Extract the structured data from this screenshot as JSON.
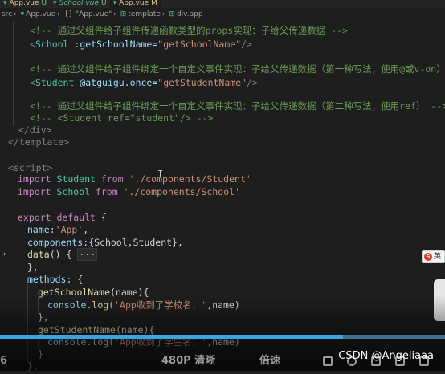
{
  "tabs": [
    {
      "label": "App.vue",
      "badge": "U",
      "label_color": "#e2c08d",
      "active": false
    },
    {
      "label": "School.vue",
      "badge": "U",
      "label_color": "#4fc08d",
      "active": false
    },
    {
      "label": "App.vue",
      "badge": "M",
      "label_color": "#e2c08d",
      "active": true
    }
  ],
  "breadcrumbs": [
    "src",
    "App.vue",
    "{} \"App.vue\"",
    "template",
    "div.app"
  ],
  "code": {
    "line_01_comment": "<!-- 通过父组件给子组件传递函数类型的props实现：子给父传递数据 -->",
    "line_02": {
      "lt": "<",
      "tag": "School",
      "attr": " :getSchoolName=",
      "value": "\"getSchoolName\"",
      "end": "/>"
    },
    "line_04_comment": "<!-- 通过父组件给子组件绑定一个自定义事件实现：子给父传递数据（第一种写法，使用@或v-on）",
    "line_05": {
      "lt": "<",
      "tag": "Student",
      "attr": " @atguigu.once=",
      "value": "\"getStudentName\"",
      "end": "/>"
    },
    "line_07_comment": "<!-- 通过父组件给子组件绑定一个自定义事件实现：子给父传递数据（第二种写法，使用ref） -->",
    "line_08_comment": "<!-- <Student ref=\"student\"/> -->",
    "line_09_close_div": "</div>",
    "line_10_close_template": "</template>",
    "line_12_script": "<script>",
    "line_13": {
      "kw": "import",
      "name": " Student ",
      "from": "from",
      "path": " './components/Student'"
    },
    "line_14": {
      "kw": "import",
      "name": " School ",
      "from": "from",
      "path": " './components/School'"
    },
    "line_16": {
      "kw": "export default",
      "rest": " {"
    },
    "line_17": {
      "key": "name",
      "sep": ":",
      "value": "'App'",
      "end": ","
    },
    "line_18": {
      "key": "components",
      "sep": ":",
      "value": "{School,Student}",
      "end": ","
    },
    "line_19": {
      "fn": "data",
      "rest": "() {",
      "folded": "···"
    },
    "line_20": "},",
    "line_21": {
      "key": "methods",
      "rest": ": {"
    },
    "line_22": {
      "fn": "getSchoolName",
      "param": "(name){"
    },
    "line_23": {
      "obj": "console",
      "fn": ".log",
      "open": "(",
      "str": "'App收到了学校名：'",
      "rest": ",name)"
    },
    "line_24": "},",
    "line_25": {
      "fn": "getStudentName",
      "param": "(name){"
    },
    "line_26": {
      "obj": "console",
      "fn": ".log",
      "open": "(",
      "str": "'App收到了学生名：'",
      "rest": ",name)"
    },
    "line_27": "}",
    "line_28": "},"
  },
  "ime": {
    "badge": "S",
    "label": "英"
  },
  "player": {
    "left_text": "6",
    "quality": "480P 清晰",
    "speed": "倍速",
    "progress": 0.77
  },
  "watermark": "CSDN @Angeliaaa",
  "colors": {
    "editor_bg": "#1e1e1e",
    "comment": "#6a9955",
    "tag": "#569cd6",
    "component": "#4ec9b0",
    "attribute": "#9cdcfe",
    "string": "#ce9178",
    "keyword": "#c586c0",
    "function": "#dcdcaa",
    "progress": "#3ba3dd"
  }
}
